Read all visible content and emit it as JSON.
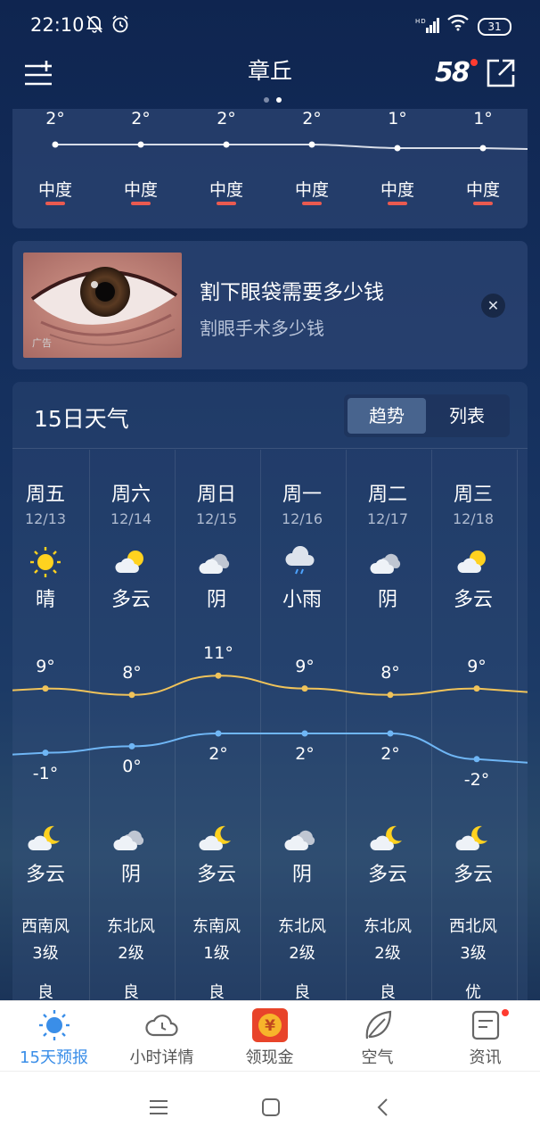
{
  "status": {
    "time": "22:10",
    "network": "HD",
    "battery": "31"
  },
  "header": {
    "city": "章丘",
    "brand": "58"
  },
  "aqi_strip": {
    "values": [
      "2°",
      "2°",
      "2°",
      "2°",
      "1°",
      "1°"
    ],
    "levels": [
      "中度",
      "中度",
      "中度",
      "中度",
      "中度",
      "中度"
    ]
  },
  "ad": {
    "title": "割下眼袋需要多少钱",
    "subtitle": "割眼手术多少钱",
    "mark": "广告"
  },
  "forecast": {
    "title": "15日天气",
    "tabs": [
      "趋势",
      "列表"
    ],
    "days": [
      {
        "name": "周五",
        "date": "12/13",
        "day_icon": "sun",
        "day_cond": "晴",
        "high": "9°",
        "low": "-1°",
        "night_icon": "moon-cloud",
        "night_cond": "多云",
        "wind_dir": "西南风",
        "wind_lvl": "3级",
        "air": "良"
      },
      {
        "name": "周六",
        "date": "12/14",
        "day_icon": "sun-cloud",
        "day_cond": "多云",
        "high": "8°",
        "low": "0°",
        "night_icon": "cloud",
        "night_cond": "阴",
        "wind_dir": "东北风",
        "wind_lvl": "2级",
        "air": "良"
      },
      {
        "name": "周日",
        "date": "12/15",
        "day_icon": "cloud",
        "day_cond": "阴",
        "high": "11°",
        "low": "2°",
        "night_icon": "moon-cloud",
        "night_cond": "多云",
        "wind_dir": "东南风",
        "wind_lvl": "1级",
        "air": "良"
      },
      {
        "name": "周一",
        "date": "12/16",
        "day_icon": "rain",
        "day_cond": "小雨",
        "high": "9°",
        "low": "2°",
        "night_icon": "cloud",
        "night_cond": "阴",
        "wind_dir": "东北风",
        "wind_lvl": "2级",
        "air": "良"
      },
      {
        "name": "周二",
        "date": "12/17",
        "day_icon": "cloud",
        "day_cond": "阴",
        "high": "8°",
        "low": "2°",
        "night_icon": "moon-cloud",
        "night_cond": "多云",
        "wind_dir": "东北风",
        "wind_lvl": "2级",
        "air": "良"
      },
      {
        "name": "周三",
        "date": "12/18",
        "day_icon": "sun-cloud",
        "day_cond": "多云",
        "high": "9°",
        "low": "-2°",
        "night_icon": "moon-cloud",
        "night_cond": "多云",
        "wind_dir": "西北风",
        "wind_lvl": "3级",
        "air": "优"
      }
    ],
    "high_values": [
      9,
      8,
      11,
      9,
      8,
      9
    ],
    "low_values": [
      -1,
      0,
      2,
      2,
      2,
      -2
    ]
  },
  "bottom_nav": [
    {
      "label": "15天预报",
      "icon": "sun-icon"
    },
    {
      "label": "小时详情",
      "icon": "clock-cloud-icon"
    },
    {
      "label": "领现金",
      "icon": "cash-icon"
    },
    {
      "label": "空气",
      "icon": "leaf-icon"
    },
    {
      "label": "资讯",
      "icon": "news-icon"
    }
  ],
  "colors": {
    "high_line": "#f0c35a",
    "low_line": "#6fb6f5",
    "level_bar": "#ea5a50",
    "active_nav": "#3a8ee8"
  }
}
